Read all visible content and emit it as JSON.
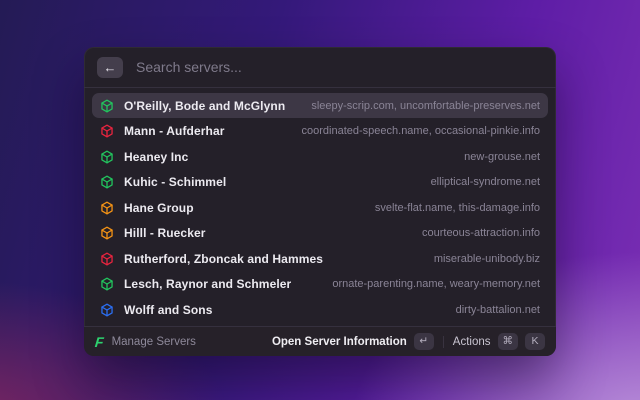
{
  "search": {
    "placeholder": "Search servers..."
  },
  "servers": [
    {
      "name": "O'Reilly, Bode and McGlynn",
      "domains": "sleepy-scrip.com, uncomfortable-preserves.net",
      "icon_color": "#22c55e",
      "selected": true
    },
    {
      "name": "Mann - Aufderhar",
      "domains": "coordinated-speech.name, occasional-pinkie.info",
      "icon_color": "#e8243f",
      "selected": false
    },
    {
      "name": "Heaney Inc",
      "domains": "new-grouse.net",
      "icon_color": "#22c55e",
      "selected": false
    },
    {
      "name": "Kuhic - Schimmel",
      "domains": "elliptical-syndrome.net",
      "icon_color": "#22c55e",
      "selected": false
    },
    {
      "name": "Hane Group",
      "domains": "svelte-flat.name, this-damage.info",
      "icon_color": "#f59315",
      "selected": false
    },
    {
      "name": "Hilll - Ruecker",
      "domains": "courteous-attraction.info",
      "icon_color": "#f59315",
      "selected": false
    },
    {
      "name": "Rutherford, Zboncak and Hammes",
      "domains": "miserable-unibody.biz",
      "icon_color": "#e8243f",
      "selected": false
    },
    {
      "name": "Lesch, Raynor and Schmeler",
      "domains": "ornate-parenting.name, weary-memory.net",
      "icon_color": "#22c55e",
      "selected": false
    },
    {
      "name": "Wolff and Sons",
      "domains": "dirty-battalion.net",
      "icon_color": "#2b6ef2",
      "selected": false
    }
  ],
  "footer": {
    "left_label": "Manage Servers",
    "primary_action": "Open Server Information",
    "primary_key": "↵",
    "secondary_action": "Actions",
    "secondary_keys": [
      "⌘",
      "K"
    ]
  },
  "icons": {
    "back": "arrow-left-icon",
    "server": "cube-icon",
    "logo": "brand-f-logo"
  },
  "colors": {
    "panel_bg": "#242029",
    "selected_row_bg": "#3d3745",
    "green": "#22c55e",
    "red": "#e8243f",
    "orange": "#f59315",
    "blue": "#2b6ef2"
  }
}
